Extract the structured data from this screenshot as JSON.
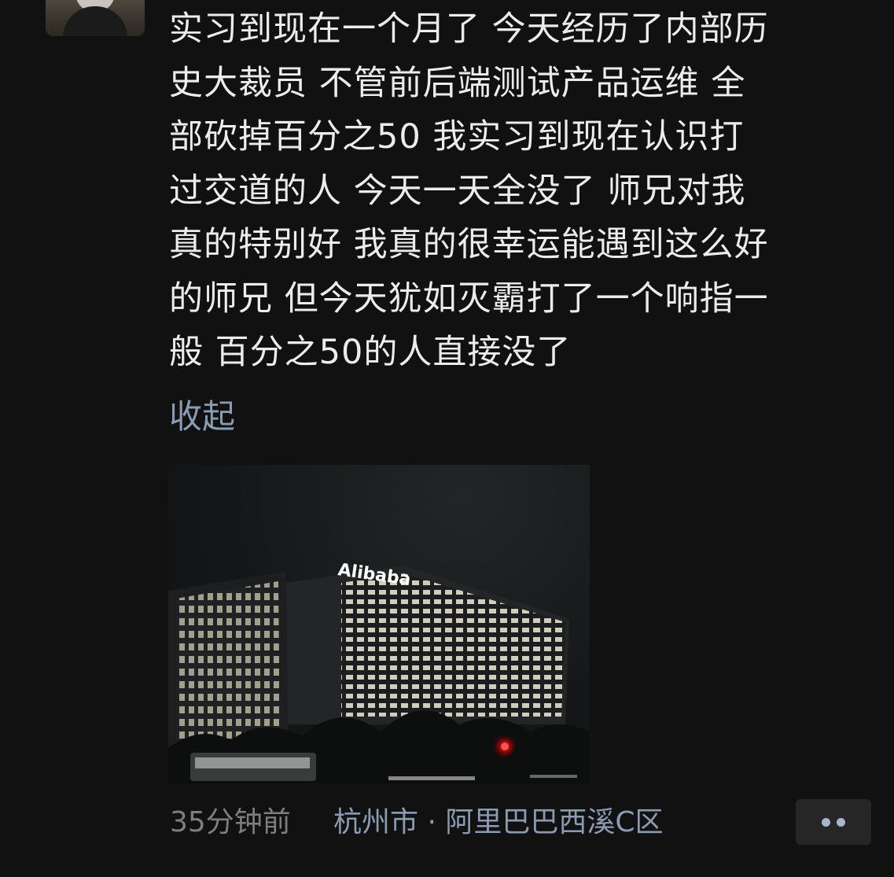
{
  "post": {
    "text_lines": [
      "实习到现在一个月了 今天经历了内部历",
      "史大裁员 不管前后端测试产品运维 全",
      "部砍掉百分之50 我实习到现在认识打",
      "过交道的人 今天一天全没了 师兄对我",
      "真的特别好 我真的很幸运能遇到这么好",
      "的师兄 但今天犹如灭霸打了一个响指一",
      "般 百分之50的人直接没了"
    ],
    "collapse_label": "收起",
    "photo_sign_text": "Alibaba",
    "time": "35分钟前",
    "location": "杭州市 · 阿里巴巴西溪C区"
  },
  "colors": {
    "background": "#111111",
    "text": "#ececec",
    "link": "#8a9bb4",
    "muted": "#7e7e7e"
  }
}
